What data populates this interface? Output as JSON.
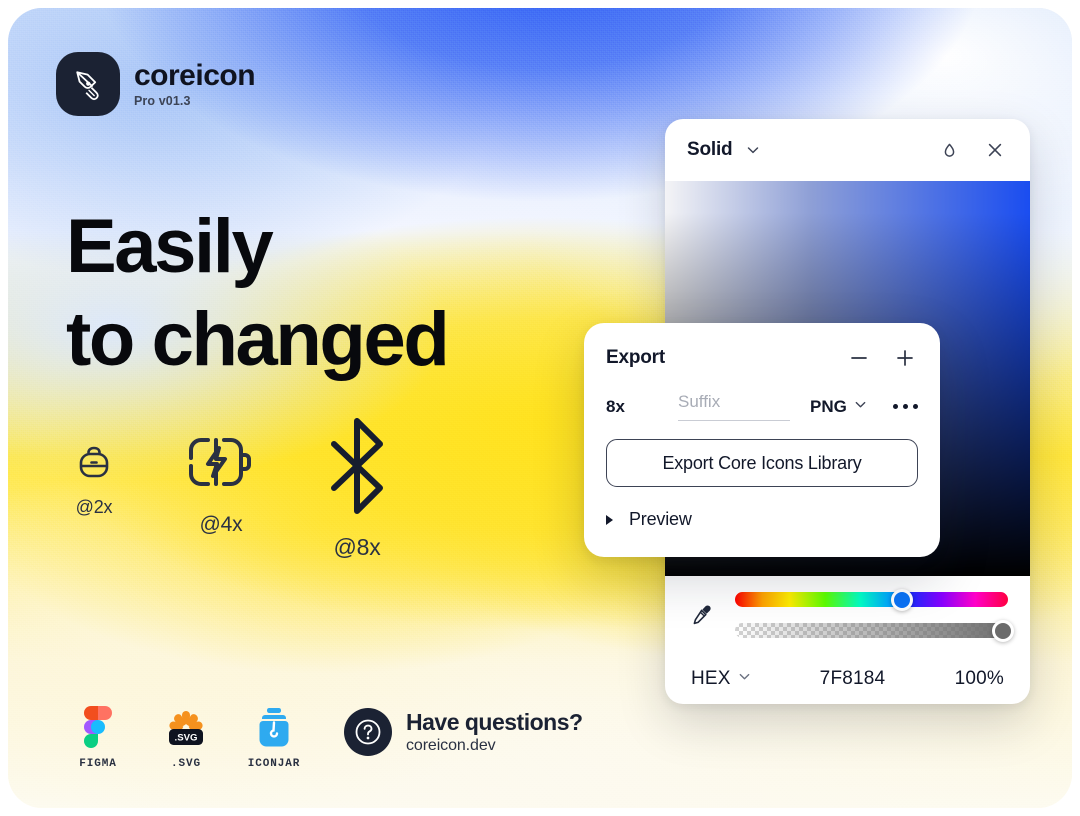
{
  "brand": {
    "name": "coreicon",
    "version": "Pro v01.3",
    "logo_icon": "pen-nib-icon"
  },
  "headline": {
    "line1": "Easily",
    "line2": "to changed"
  },
  "showcase": {
    "items": [
      {
        "icon": "backpack-icon",
        "label": "@2x"
      },
      {
        "icon": "battery-charging-icon",
        "label": "@4x"
      },
      {
        "icon": "bluetooth-icon",
        "label": "@8x"
      }
    ]
  },
  "footer": {
    "formats": [
      {
        "icon": "figma-logo-icon",
        "label": "FIGMA"
      },
      {
        "icon": "svg-badge-icon",
        "label": ".SVG"
      },
      {
        "icon": "iconjar-logo-icon",
        "label": "ICONJAR"
      }
    ],
    "help": {
      "icon": "question-mark-icon",
      "title": "Have questions?",
      "url": "coreicon.dev"
    }
  },
  "color_picker": {
    "title": "Solid",
    "chevron_icon": "chevron-down-icon",
    "droplet_icon": "droplet-icon",
    "close_icon": "close-icon",
    "eyedropper_icon": "eyedropper-icon",
    "mode": "HEX",
    "mode_chevron_icon": "chevron-down-icon",
    "hex_value": "7F8184",
    "alpha_value": "100%"
  },
  "export_panel": {
    "title": "Export",
    "minus_icon": "minus-icon",
    "plus_icon": "plus-icon",
    "scale": "8x",
    "suffix_placeholder": "Suffix",
    "format": "PNG",
    "format_chevron_icon": "chevron-down-icon",
    "more_icon": "more-horizontal-icon",
    "cta_label": "Export Core Icons Library",
    "preview_label": "Preview",
    "preview_toggle_icon": "triangle-right-icon"
  },
  "colors": {
    "brand_dark": "#1b2233",
    "accent_blue": "#2d5df5",
    "accent_yellow": "#ffe21f",
    "hue_knob": "#0b72f5"
  }
}
